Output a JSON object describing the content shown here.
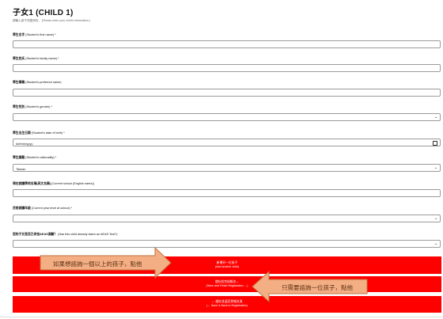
{
  "header": {
    "title": "子女1 (CHILD 1)",
    "subtitle": "請輸入孩子完整資料。 (Please enter your child's information.)"
  },
  "fields": [
    {
      "label_zh": "學生名字",
      "label_en": "(Student's first name)",
      "required": "*",
      "value": "",
      "type": "text"
    },
    {
      "label_zh": "學生姓氏",
      "label_en": "(Student's family name)",
      "required": "*",
      "value": "",
      "type": "text"
    },
    {
      "label_zh": "學生暱稱",
      "label_en": "(Student's preferred name)",
      "required": "",
      "value": "",
      "type": "text"
    },
    {
      "label_zh": "學生性別",
      "label_en": "(Student's gender)",
      "required": "*",
      "value": "",
      "type": "select"
    },
    {
      "label_zh": "學生出生日期",
      "label_en": "(Student's date of birth)",
      "required": "*",
      "value": "dd/mm/yyyy",
      "type": "date"
    },
    {
      "label_zh": "學生國籍",
      "label_en": "(Student's nationality)",
      "required": "*",
      "value": "Taiwan",
      "type": "select"
    },
    {
      "label_zh": "現在就讀學校名稱(英文名稱)",
      "label_en": "(Current school (English name))",
      "required": "",
      "value": "",
      "type": "text"
    },
    {
      "label_zh": "目前就讀年級",
      "label_en": "(Current year level at school)",
      "required": "*",
      "value": "",
      "type": "select"
    },
    {
      "label_zh": "您的子女是否已參加AEAS測驗？",
      "label_en": "(Has this child already taken an AEAS Test?)",
      "required": "",
      "value": "",
      "type": "select"
    }
  ],
  "buttons": {
    "add_child_zh": "新增另一位孩子",
    "add_child_en": "(Add another child)",
    "save_finish_zh": "儲存並完成報名→",
    "save_finish_en": "(Save and Finish Registration →)",
    "save_back_zh": "← 儲存並返回到報名頁",
    "save_back_en": "(← Save & Back to Registration)"
  },
  "callouts": {
    "multiple_children": "如果想諮詢一個以上的孩子，點他",
    "one_child": "只需要諮詢一位孩子，點他"
  },
  "icons": {
    "select": "chevron-down-icon",
    "date": "calendar-icon"
  },
  "colors": {
    "button_red": "#ff0000",
    "callout_fill": "#f4ae84",
    "callout_stroke": "#c2713f"
  }
}
